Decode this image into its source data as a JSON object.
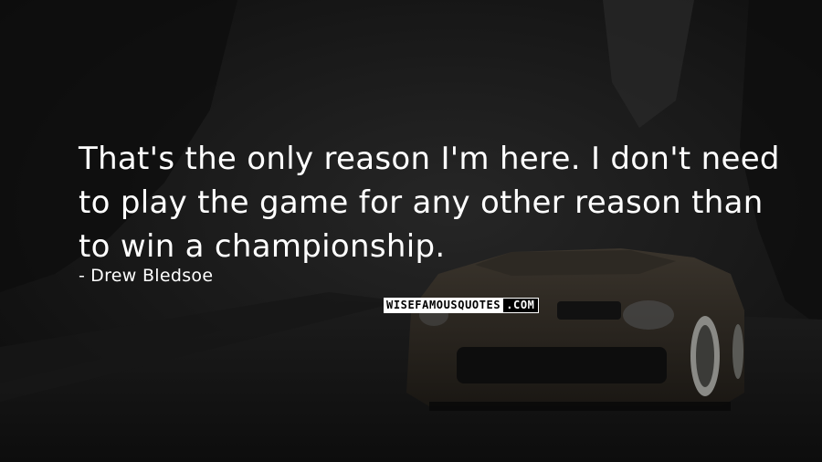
{
  "quote": {
    "text": "That's the only reason I'm here. I don't need to play the game for any other reason than to win a championship.",
    "author": "Drew Bledsoe",
    "dash": "-"
  },
  "logo": {
    "main": "WISEFAMOUSQUOTES",
    "tld": ".COM"
  },
  "colors": {
    "text": "#ffffff",
    "background": "#121212"
  }
}
